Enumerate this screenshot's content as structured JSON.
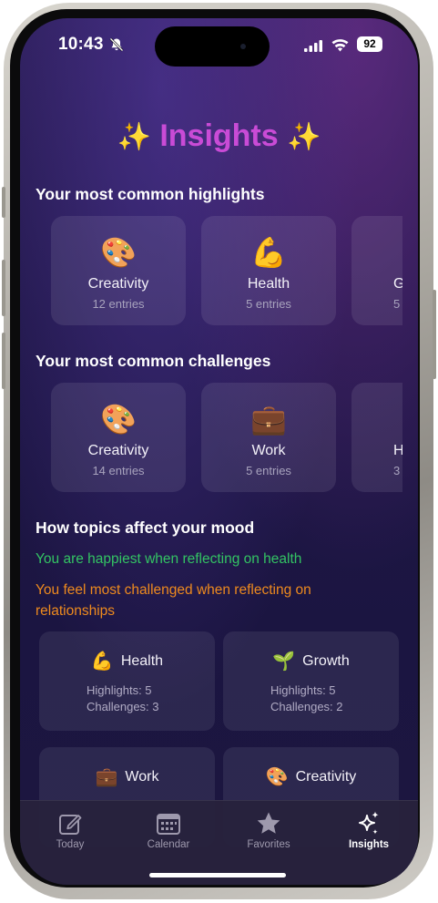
{
  "status_bar": {
    "time": "10:43",
    "battery": "92"
  },
  "page": {
    "title": "Insights",
    "sparkle": "✨"
  },
  "highlights": {
    "title": "Your most common highlights",
    "items": [
      {
        "emoji": "🎨",
        "name": "Creativity",
        "count": "12 entries"
      },
      {
        "emoji": "💪",
        "name": "Health",
        "count": "5 entries"
      },
      {
        "emoji": "",
        "name": "G",
        "count": "5"
      }
    ]
  },
  "challenges": {
    "title": "Your most common challenges",
    "items": [
      {
        "emoji": "🎨",
        "name": "Creativity",
        "count": "14 entries"
      },
      {
        "emoji": "💼",
        "name": "Work",
        "count": "5 entries"
      },
      {
        "emoji": "",
        "name": "H",
        "count": "3"
      }
    ]
  },
  "mood": {
    "title": "How topics affect your mood",
    "happiest": "You are happiest when reflecting on health",
    "challenged": "You feel most challenged when reflecting on relationships",
    "cards": [
      {
        "emoji": "💪",
        "name": "Health",
        "highlights": "Highlights: 5",
        "challenges": "Challenges: 3"
      },
      {
        "emoji": "🌱",
        "name": "Growth",
        "highlights": "Highlights: 5",
        "challenges": "Challenges: 2"
      },
      {
        "emoji": "💼",
        "name": "Work",
        "highlights": "",
        "challenges": ""
      },
      {
        "emoji": "🎨",
        "name": "Creativity",
        "highlights": "",
        "challenges": ""
      }
    ]
  },
  "tabs": [
    {
      "label": "Today",
      "icon": "compose-icon",
      "active": false
    },
    {
      "label": "Calendar",
      "icon": "calendar-icon",
      "active": false
    },
    {
      "label": "Favorites",
      "icon": "star-icon",
      "active": false
    },
    {
      "label": "Insights",
      "icon": "sparkles-icon",
      "active": true
    }
  ],
  "colors": {
    "title": "#c94bd6",
    "happy": "#33c463",
    "challenged": "#ee8a1e",
    "background": "#1f1747"
  }
}
